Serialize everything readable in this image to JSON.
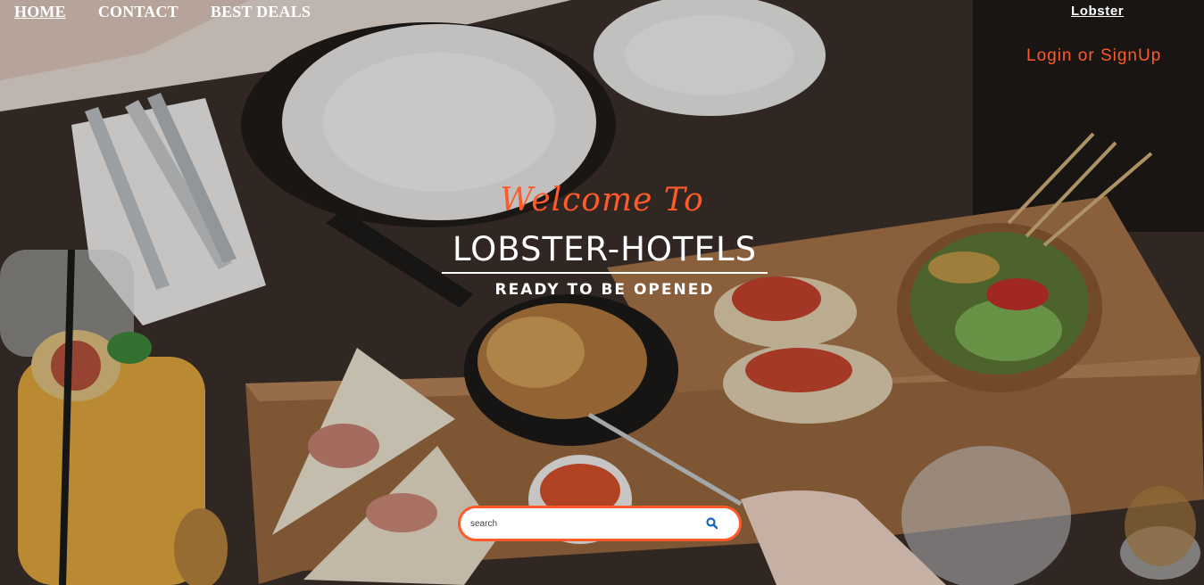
{
  "nav": {
    "items": [
      {
        "label": "HOME",
        "active": true
      },
      {
        "label": "CONTACT",
        "active": false
      },
      {
        "label": "BEST DEALS",
        "active": false
      }
    ]
  },
  "header": {
    "brand": "Lobster",
    "login": "Login or SignUp"
  },
  "hero": {
    "welcome": "Welcome To",
    "title": "LOBSTER-HOTELS",
    "subtitle": "READY TO BE OPENED"
  },
  "search": {
    "placeholder": "search",
    "icon": "search-icon"
  },
  "colors": {
    "accent": "#ff5a2a",
    "search_icon": "#1565c0"
  }
}
